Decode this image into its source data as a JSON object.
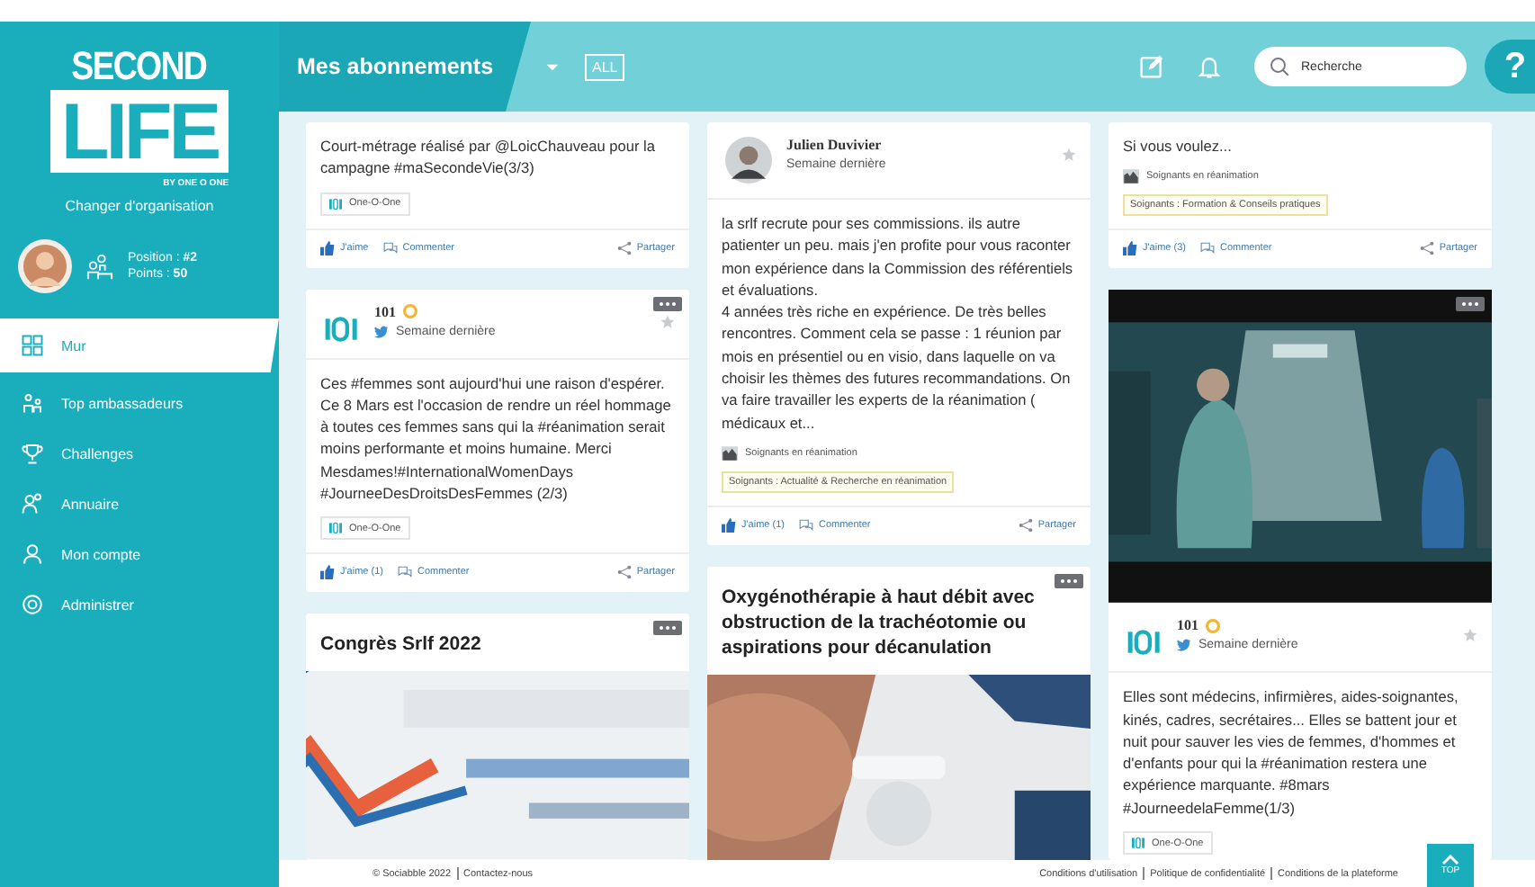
{
  "sidebar": {
    "logo": {
      "top": "SECOND",
      "main": "LIFE",
      "tagline": "BY ONE O ONE"
    },
    "change_org": "Changer d'organisation",
    "user": {
      "position": "Position : **#2**",
      "points": "Points : **50**"
    },
    "nav": [
      {
        "label": "Mur",
        "selected": true
      },
      {
        "label": "Top ambassadeurs",
        "selected": false
      },
      {
        "label": "Challenges",
        "selected": false
      },
      {
        "label": "Annuaire",
        "selected": false
      },
      {
        "label": "Mon compte",
        "selected": false
      },
      {
        "label": "Administrer",
        "selected": false
      }
    ]
  },
  "header": {
    "title": "Mes abonnements",
    "filter": "ALL",
    "search": {
      "placeholder": "Recherche"
    },
    "help": "?"
  },
  "columns": [
    [
      {
        "menu": false,
        "parts": [
          {
            "kind": "text",
            "text": "Court-métrage réalisé par @LoicChauveau pour la campagne #maSecondeVie(3/3)"
          },
          {
            "kind": "channel",
            "text": "One-O-One"
          },
          {
            "kind": "actions",
            "like": "J'aime",
            "comment": "Commenter",
            "share": "Partager"
          }
        ]
      },
      {
        "menu": true,
        "parts": [
          {
            "kind": "org_author",
            "name": "101",
            "badge": true,
            "via_twitter": true,
            "time": "Semaine dernière",
            "favorite": false
          },
          {
            "kind": "text",
            "text": "Ces #femmes sont aujourd'hui une raison d'espérer. Ce 8 Mars est l'occasion de rendre un réel hommage à toutes ces femmes sans qui la #réanimation serait moins performante et moins humaine. Merci Mesdames!#InternationalWomenDays #JourneeDesDroitsDesFemmes (2/3)"
          },
          {
            "kind": "channel",
            "text": "One-O-One"
          },
          {
            "kind": "actions",
            "like": "J'aime (1)",
            "comment": "Commenter",
            "share": "Partager"
          }
        ]
      },
      {
        "menu": true,
        "parts": [
          {
            "kind": "title",
            "text": "Congrès Srlf 2022"
          },
          {
            "kind": "media"
          }
        ]
      }
    ],
    [
      {
        "menu": false,
        "parts": [
          {
            "kind": "person_author",
            "name": "Julien Duvivier",
            "time": "Semaine dernière",
            "favorite": false
          },
          {
            "kind": "text",
            "text": "la srlf recrute pour ses commissions. ils autre patienter un peu. mais j'en profite pour vous raconter mon expérience dans la Commission des référentiels et évaluations.\n4 années très riche en expérience. De très belles rencontres. Comment cela se passe : 1 réunion par mois en présentiel ou en visio, dans laquelle on va choisir les thèmes des futures recommandations. On va faire travailler les experts de la réanimation ( médicaux et..."
          },
          {
            "kind": "group",
            "text": "Soignants en réanimation"
          },
          {
            "kind": "tag",
            "text": "Soignants : Actualité & Recherche en réanimation"
          },
          {
            "kind": "actions",
            "like": "J'aime (1)",
            "comment": "Commenter",
            "share": "Partager"
          }
        ]
      },
      {
        "menu": true,
        "parts": [
          {
            "kind": "title",
            "text": "Oxygénothérapie à haut débit avec obstruction de la trachéotomie ou aspirations pour décanulation"
          },
          {
            "kind": "media"
          }
        ]
      }
    ],
    [
      {
        "menu": false,
        "parts": [
          {
            "kind": "text",
            "text": "Si vous voulez..."
          },
          {
            "kind": "group",
            "text": "Soignants en réanimation"
          },
          {
            "kind": "tag",
            "text": "Soignants : Formation & Conseils pratiques"
          },
          {
            "kind": "actions",
            "like": "J'aime (3)",
            "comment": "Commenter",
            "share": "Partager"
          }
        ]
      },
      {
        "menu": true,
        "parts": [
          {
            "kind": "media"
          },
          {
            "kind": "org_author",
            "name": "101",
            "badge": true,
            "via_twitter": true,
            "time": "Semaine dernière",
            "favorite": false
          },
          {
            "kind": "text",
            "text": "Elles sont médecins, infirmières, aides-soignantes, kinés, cadres, secrétaires... Elles se battent jour et nuit pour sauver les vies de femmes, d'hommes et d'enfants pour qui la #réanimation restera une expérience marquante. #8mars #JourneedelaFemme(1/3)"
          },
          {
            "kind": "channel",
            "text": "One-O-One"
          }
        ]
      }
    ]
  ],
  "footer": {
    "left": [
      "© Sociabble 2022",
      "Contactez-nous"
    ],
    "right": [
      "Conditions d'utilisation",
      "Politique de confidentialité",
      "Conditions de la plateforme"
    ],
    "top": "TOP"
  }
}
